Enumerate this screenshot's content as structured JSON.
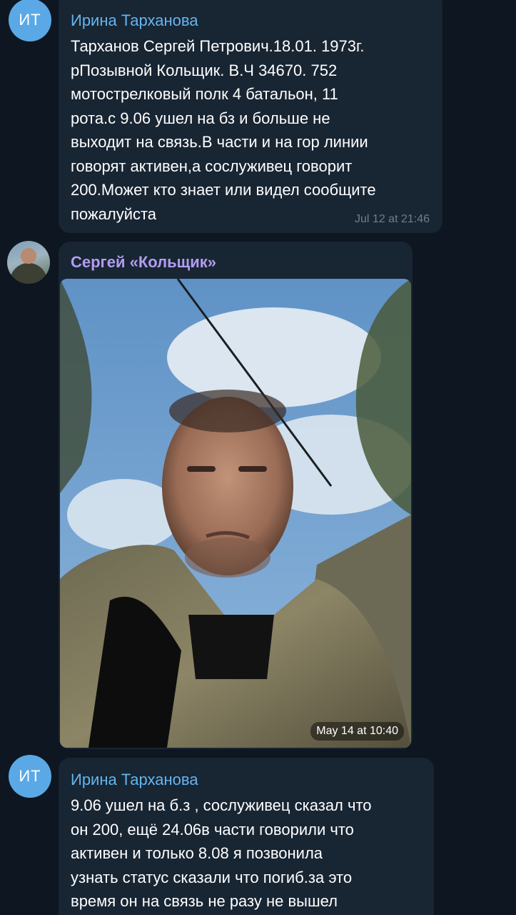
{
  "messages": [
    {
      "avatar_initials": "ИТ",
      "sender": "Ирина Тарханова",
      "text": "Тарханов Сергей Петрович.18.01. 1973г.\nрПозывной Кольщик. В.Ч 34670. 752\nмотострелковый полк 4 батальон, 11\nрота.с 9.06 ушел на бз и больше не\nвыходит на связь.В части и на гор линии\nговорят активен,а сослуживец говорит\n200.Может кто знает или видел сообщите\nпожалуйста",
      "time": "Jul 12 at 21:46"
    },
    {
      "sender": "Сергей «Кольщик»",
      "photo_time": "May 14 at 10:40"
    },
    {
      "avatar_initials": "ИТ",
      "sender": "Ирина Тарханова",
      "text": "9.06 ушел на б.з , сослуживец сказал что\nон 200, ещё 24.06в части  говорили что\nактивен и только 8.08 я позвонила\nузнать статус сказали что погиб.за это\nвремя он на связь не разу не вышел"
    }
  ],
  "colors": {
    "background": "#0e1621",
    "bubble": "#182533",
    "sender_blue": "#64b5ef",
    "sender_violet": "#b29df0",
    "avatar_blue": "#5aa9e6",
    "timestamp": "#6d7f8f"
  }
}
